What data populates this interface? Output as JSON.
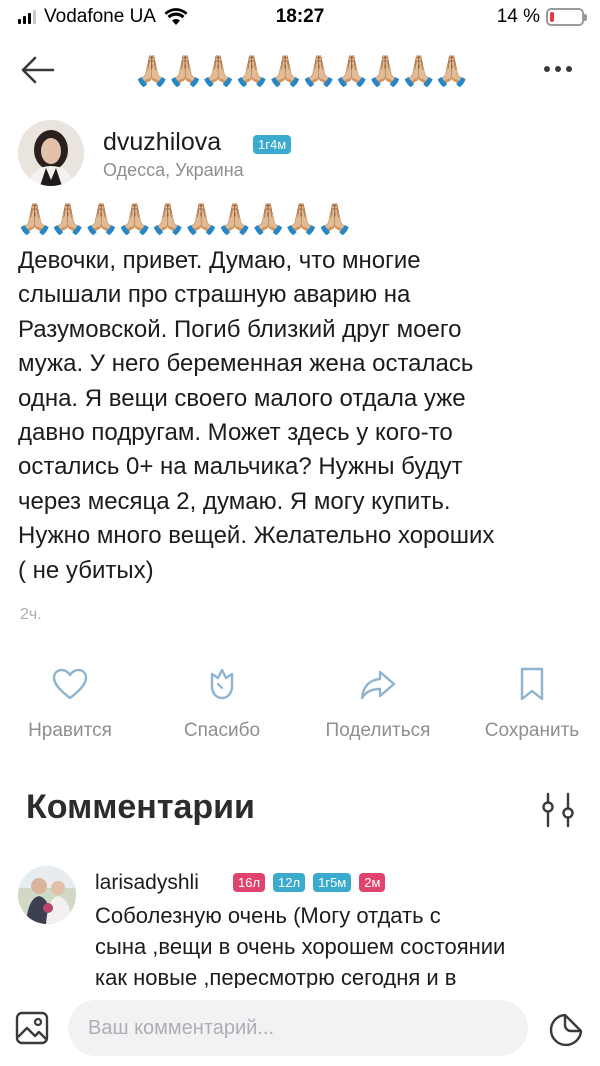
{
  "status_bar": {
    "carrier": "Vodafone UA",
    "time": "18:27",
    "battery_percent": "14 %",
    "battery_level": 0.14,
    "battery_color": "#e5393a"
  },
  "nav": {
    "title": "🙏🏼🙏🏼🙏🏼🙏🏼🙏🏼🙏🏼🙏🏼🙏🏼🙏🏼🙏🏼",
    "back_icon": "arrow-left-icon",
    "more_icon": "more-dots-icon"
  },
  "post": {
    "author": {
      "username": "dvuzhilova",
      "badge": "1г4м",
      "location": "Одесса, Украина"
    },
    "emoji_line": "🙏🏼🙏🏼🙏🏼🙏🏼🙏🏼🙏🏼🙏🏼🙏🏼🙏🏼🙏🏼",
    "text": "Девочки, привет. Думаю, что многие\nслышали про страшную аварию на\nРазумовской. Погиб близкий друг моего\nмужа. У него беременная жена осталась\nодна. Я вещи своего малого отдала уже\nдавно подругам. Может здесь у кого-то\nостались 0+ на мальчика? Нужны будут\nчерез месяца 2, думаю. Я могу купить.\nНужно много вещей. Желательно хороших\n( не убитых)",
    "time": "2ч."
  },
  "actions": {
    "like": "Нравится",
    "thanks": "Спасибо",
    "share": "Поделиться",
    "save": "Сохранить"
  },
  "comments": {
    "title": "Комментарии",
    "items": [
      {
        "username": "larisadyshli",
        "badges": [
          {
            "text": "16л",
            "color": "#e0446e"
          },
          {
            "text": "12л",
            "color": "#3aaacd"
          },
          {
            "text": "1г5м",
            "color": "#3aaacd"
          },
          {
            "text": "2м",
            "color": "#e0446e"
          }
        ],
        "text": "Соболезную очень (Могу отдать с\nсына ,вещи в очень хорошем состоянии\nкак новые ,пересмотрю сегодня и в"
      }
    ]
  },
  "input": {
    "placeholder": "Ваш комментарий..."
  },
  "colors": {
    "accent_blue": "#3aaacd",
    "accent_pink": "#e0446e",
    "muted_text": "#8e8e93"
  }
}
